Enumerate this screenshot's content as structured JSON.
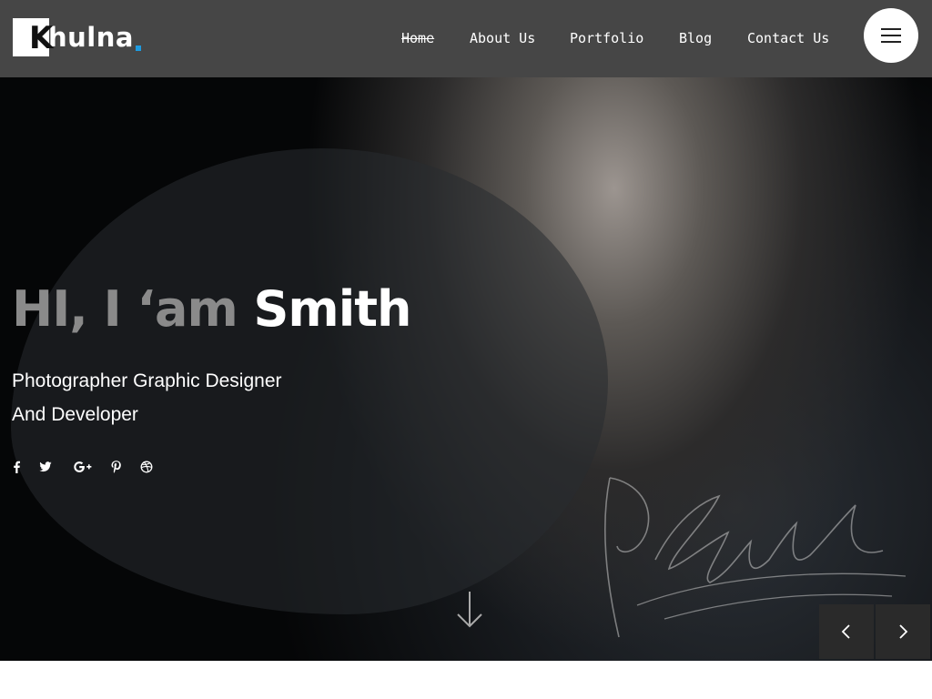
{
  "logo": {
    "letter": "K",
    "text": "hulna",
    "dot_color": "#1e9be0"
  },
  "nav": {
    "items": [
      {
        "label": "Home",
        "active": true
      },
      {
        "label": "About Us",
        "active": false
      },
      {
        "label": "Portfolio",
        "active": false
      },
      {
        "label": "Blog",
        "active": false
      },
      {
        "label": "Contact Us",
        "active": false
      }
    ],
    "menu_icon": "hamburger-icon"
  },
  "hero": {
    "title_prefix": "HI, I ‘am",
    "title_name": "Smith",
    "subtitle_line1": "Photographer Graphic Designer",
    "subtitle_line2": "And Developer",
    "social_icons": [
      "facebook-icon",
      "twitter-icon",
      "google-plus-icon",
      "pinterest-icon",
      "dribbble-icon"
    ],
    "signature": "P. Smith",
    "scroll_icon": "arrow-down-icon"
  },
  "slider": {
    "prev_icon": "chevron-left-icon",
    "next_icon": "chevron-right-icon"
  },
  "colors": {
    "header_bg": "#464646",
    "hero_bg": "#050607",
    "accent": "#1e9be0",
    "title_muted": "#8a8a8a",
    "text": "#ffffff"
  }
}
